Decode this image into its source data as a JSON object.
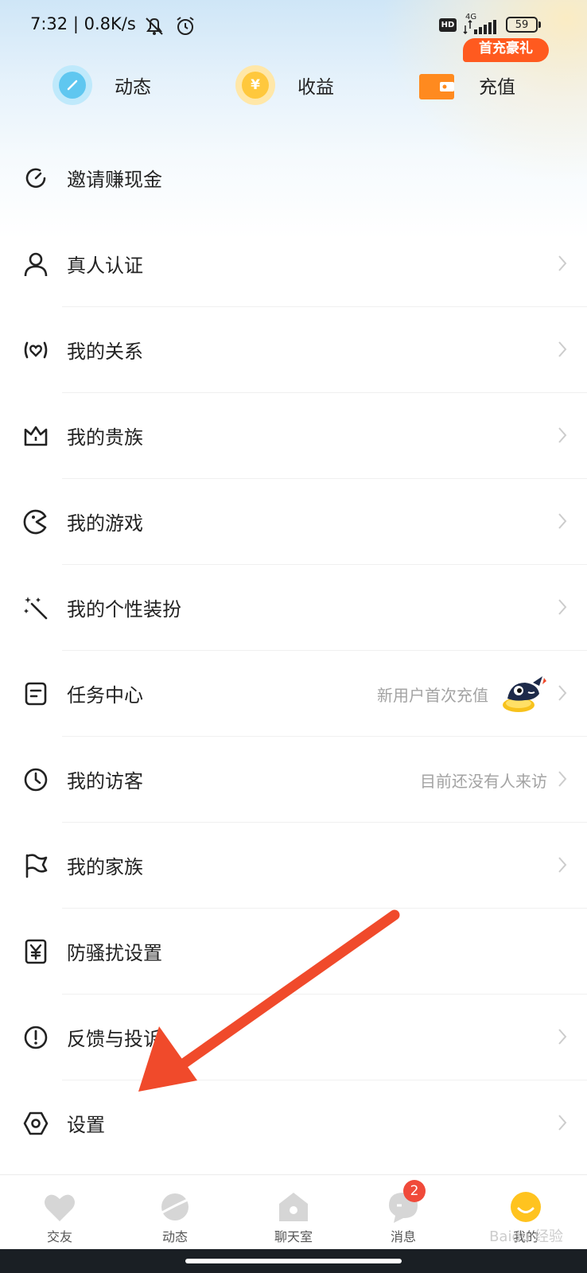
{
  "status_bar": {
    "time": "7:32 | 0.8K/s",
    "network": "4G",
    "hd": "HD",
    "battery": "59"
  },
  "top_actions": [
    {
      "label": "动态",
      "icon": "pencil-icon",
      "color": "#5fc7f0"
    },
    {
      "label": "收益",
      "icon": "yuan-coin-icon",
      "color": "#ffc83d"
    },
    {
      "label": "充值",
      "icon": "wallet-icon",
      "color": "#ff8a1f"
    }
  ],
  "recharge_badge": "首充豪礼",
  "menu": [
    {
      "label": "邀请赚现金",
      "icon": "refresh-icon",
      "hint": "",
      "chevron": false
    },
    {
      "label": "真人认证",
      "icon": "person-icon",
      "hint": "",
      "chevron": true
    },
    {
      "label": "我的关系",
      "icon": "heart-chat-icon",
      "hint": "",
      "chevron": true
    },
    {
      "label": "我的贵族",
      "icon": "crown-icon",
      "hint": "",
      "chevron": true
    },
    {
      "label": "我的游戏",
      "icon": "game-icon",
      "hint": "",
      "chevron": true
    },
    {
      "label": "我的个性装扮",
      "icon": "magic-wand-icon",
      "hint": "",
      "chevron": true
    },
    {
      "label": "任务中心",
      "icon": "task-icon",
      "hint": "新用户首次充值",
      "chevron": true
    },
    {
      "label": "我的访客",
      "icon": "clock-icon",
      "hint": "目前还没有人来访",
      "chevron": true
    },
    {
      "label": "我的家族",
      "icon": "flag-icon",
      "hint": "",
      "chevron": true
    },
    {
      "label": "防骚扰设置",
      "icon": "shield-yuan-icon",
      "hint": "",
      "chevron": false
    },
    {
      "label": "反馈与投诉",
      "icon": "alert-icon",
      "hint": "",
      "chevron": true
    },
    {
      "label": "设置",
      "icon": "settings-icon",
      "hint": "",
      "chevron": true
    }
  ],
  "bottom_nav": [
    {
      "label": "交友",
      "icon": "heart-icon"
    },
    {
      "label": "动态",
      "icon": "planet-icon"
    },
    {
      "label": "聊天室",
      "icon": "chatroom-icon"
    },
    {
      "label": "消息",
      "icon": "message-icon",
      "badge": "2"
    },
    {
      "label": "我的",
      "icon": "smile-icon"
    }
  ],
  "watermark": "Baidu 经验",
  "accent_color": "#f04a2b"
}
